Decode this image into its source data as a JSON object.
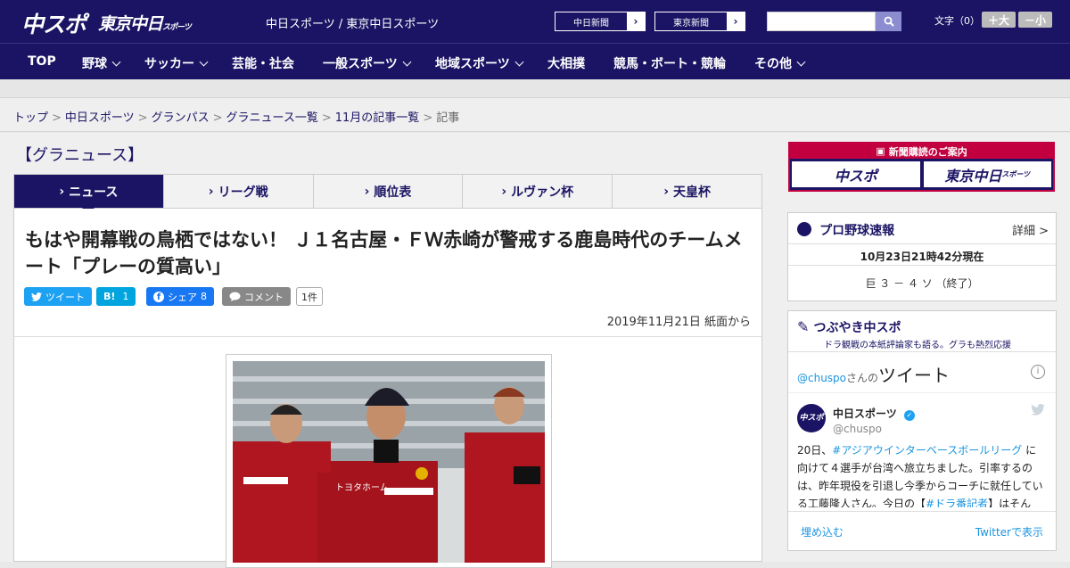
{
  "header": {
    "logo_main": "中スポ",
    "logo_sub": "東京中日",
    "logo_sub_small": "スポーツ",
    "site_names": "中日スポーツ / 東京中日スポーツ",
    "paper_links": [
      {
        "label": "中日新聞",
        "arrow": "›"
      },
      {
        "label": "東京新聞",
        "arrow": "›"
      }
    ],
    "font_size_label": "文字（0）",
    "font_bigger": "＋大",
    "font_smaller": "－小"
  },
  "nav": [
    {
      "label": "TOP",
      "dropdown": false
    },
    {
      "label": "野球",
      "dropdown": true
    },
    {
      "label": "サッカー",
      "dropdown": true
    },
    {
      "label": "芸能・社会",
      "dropdown": false
    },
    {
      "label": "一般スポーツ",
      "dropdown": true
    },
    {
      "label": "地域スポーツ",
      "dropdown": true
    },
    {
      "label": "大相撲",
      "dropdown": false
    },
    {
      "label": "競馬・ボート・競輪",
      "dropdown": false
    },
    {
      "label": "その他",
      "dropdown": true
    }
  ],
  "breadcrumb": {
    "items": [
      "トップ",
      "中日スポーツ",
      "グランパス",
      "グラニュース一覧",
      "11月の記事一覧"
    ],
    "current": "記事",
    "separator": ">"
  },
  "section_title": "【グラニュース】",
  "tabs": [
    {
      "label": "ニュース",
      "active": true
    },
    {
      "label": "リーグ戦",
      "active": false
    },
    {
      "label": "順位表",
      "active": false
    },
    {
      "label": "ルヴァン杯",
      "active": false
    },
    {
      "label": "天皇杯",
      "active": false
    }
  ],
  "tab_marker": "›",
  "article": {
    "headline": "もはや開幕戦の鳥栖ではない！ Ｊ１名古屋・ＦＷ赤崎が警戒する鹿島時代のチームメート「プレーの質高い」",
    "share": {
      "tweet": "ツイート",
      "hatena": "B!",
      "hatena_count": "1",
      "facebook": "シェア",
      "facebook_count": "8",
      "comment": "コメント",
      "comment_count": "1件"
    },
    "date": "2019年11月21日 紙面から",
    "photo_shirt_text": "トヨタホーム"
  },
  "sidebar": {
    "ad": {
      "strip": "新聞購読のご案内",
      "left": "中スポ",
      "right": "東京中日",
      "right_small": "スポーツ"
    },
    "baseball": {
      "title": "プロ野球速報",
      "detail": "詳細 >",
      "timestamp": "10月23日21時42分現在",
      "score": "巨 ３ － ４ ソ （終了）"
    },
    "tsubuyaki": {
      "title": "つぶやき中スポ",
      "subtitle": "ドラ観戦の本紙評論家も語る。グラも熱烈応援",
      "handle": "@chuspo",
      "handle_suffix": "さんの",
      "tweets_label": "ツイート",
      "author": "中日スポーツ",
      "author_handle": "@chuspo",
      "avatar": "中スポ",
      "tweet_part1": "20日、",
      "tweet_hashtag1": "#アジアウインターベースボールリーグ",
      "tweet_part2": " に向けて４選手が台湾へ旅立ちました。引率するのは、昨年現役を引退し今季からコーチに就任している工藤隆人さん。今日の【",
      "tweet_hashtag2": "#ドラ番記者",
      "tweet_part3": "】はそんな“新米",
      "embed": "埋め込む",
      "view_on_twitter": "Twitterで表示"
    }
  },
  "colors": {
    "brand_navy": "#1b1464",
    "ad_red": "#c2003f",
    "twitter_blue": "#1da1f2",
    "facebook_blue": "#1877f2",
    "hatena_blue": "#00a4de"
  }
}
